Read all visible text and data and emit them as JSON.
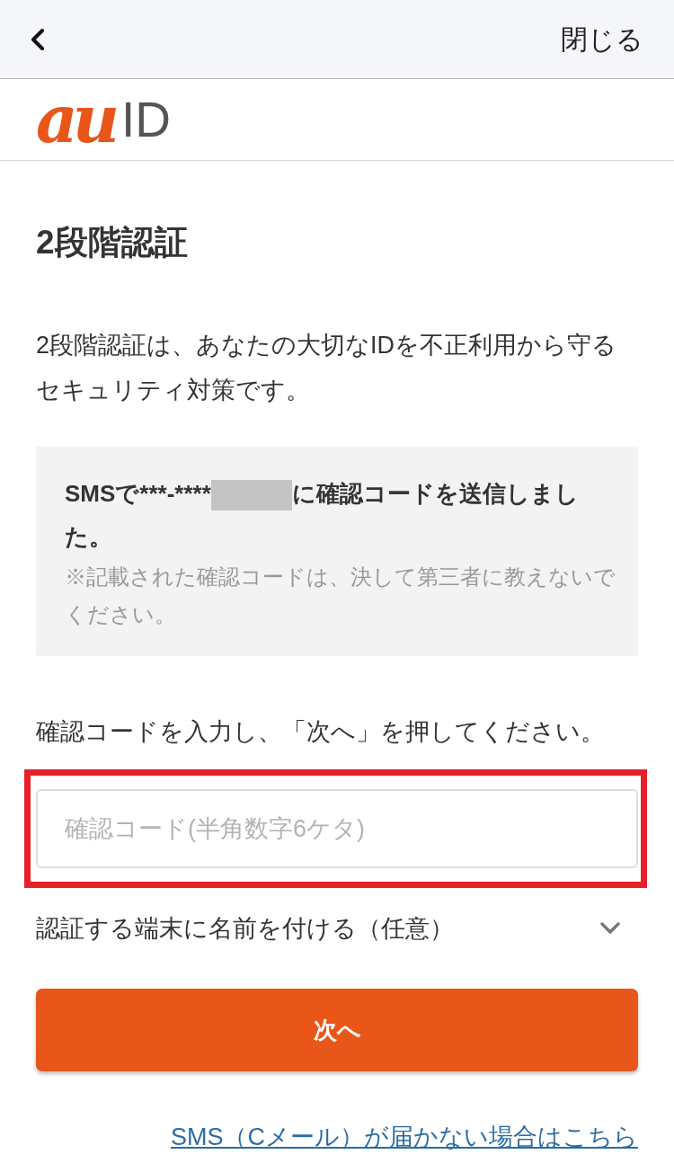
{
  "header": {
    "close_label": "閉じる"
  },
  "logo": {
    "brand": "au",
    "suffix": "ID"
  },
  "title": "2段階認証",
  "description": "2段階認証は、あなたの大切なIDを不正利用から守るセキュリティ対策です。",
  "sms_notice": {
    "message_before": "SMSで***-****",
    "redacted": true,
    "message_after": "に確認コードを送信しました。",
    "note": "※記載された確認コードは、決して第三者に教えないでください。"
  },
  "instruction": "確認コードを入力し、「次へ」を押してください。",
  "code_input": {
    "placeholder": "確認コード(半角数字6ケタ)",
    "highlighted": true
  },
  "device_name": {
    "label": "認証する端末に名前を付ける（任意）",
    "expanded": false
  },
  "next_button": "次へ",
  "help_link": "SMS（Cメール）が届かない場合はこちら"
}
